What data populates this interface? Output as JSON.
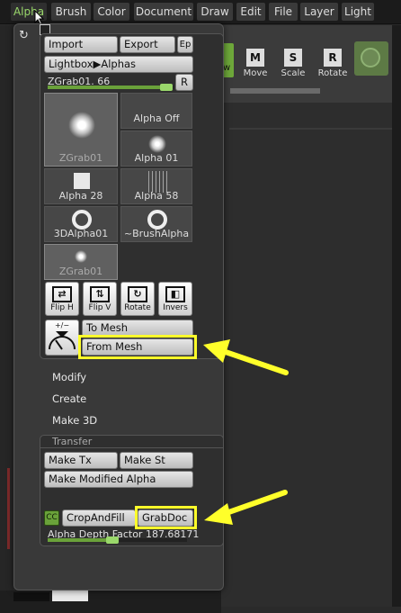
{
  "menubar": {
    "items": [
      "Alpha",
      "Brush",
      "Color",
      "Document",
      "Draw",
      "Edit",
      "File",
      "Layer",
      "Light"
    ],
    "active": "Alpha"
  },
  "shelf": {
    "tools": [
      {
        "label": "Move",
        "icon": "M"
      },
      {
        "label": "Scale",
        "icon": "S"
      },
      {
        "label": "Rotate",
        "icon": "R"
      }
    ],
    "partial_label": "w"
  },
  "popup": {
    "pin_icon": "↻",
    "top_buttons": {
      "import": "Import",
      "export": "Export",
      "ep": "Ep"
    },
    "lightbox": "Lightbox▶Alphas",
    "zgrab": {
      "label": "ZGrab01. 66",
      "r": "R",
      "level": 0.95
    },
    "tiles": [
      {
        "caption": "ZGrab01"
      },
      {
        "caption": "Alpha Off"
      },
      {
        "caption": "Alpha 01"
      },
      {
        "caption": "Alpha 28"
      },
      {
        "caption": "Alpha 58"
      },
      {
        "caption": "3DAlpha01"
      },
      {
        "caption": "~BrushAlpha"
      },
      {
        "caption": "ZGrab01"
      }
    ],
    "tools": [
      {
        "label": "Flip H",
        "glyph": "⇄"
      },
      {
        "label": "Flip V",
        "glyph": "⇅"
      },
      {
        "label": "Rotate",
        "glyph": "↻"
      },
      {
        "label": "Invers",
        "glyph": "◧"
      }
    ],
    "mesh": {
      "to_mesh": "To Mesh",
      "from_mesh": "From Mesh",
      "midpoint_icon": "+/−"
    },
    "items": {
      "modify": "Modify",
      "create": "Create",
      "make3d": "Make 3D"
    },
    "transfer": {
      "title": "Transfer",
      "make_tx": "Make Tx",
      "make_st": "Make St",
      "make_modified": "Make Modified Alpha",
      "cc": "CC",
      "crop_and_fill": "CropAndFill",
      "grab_doc": "GrabDoc",
      "depth_label": "Alpha Depth Factor 187.68171",
      "depth_level": 0.45
    }
  },
  "annotation_color": "#ffff2a"
}
